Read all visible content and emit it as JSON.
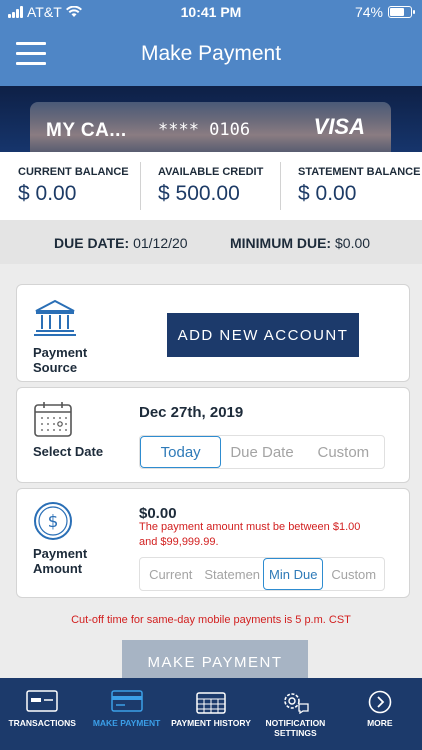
{
  "status_bar": {
    "carrier": "AT&T",
    "time": "10:41 PM",
    "battery": "74%",
    "battery_level": 0.74
  },
  "header": {
    "title": "Make Payment"
  },
  "card": {
    "name": "MY CA...",
    "masked_number": "**** 0106",
    "brand": "VISA"
  },
  "balances": [
    {
      "label": "CURRENT BALANCE",
      "amount": "$ 0.00"
    },
    {
      "label": "AVAILABLE CREDIT",
      "amount": "$ 500.00"
    },
    {
      "label": "STATEMENT BALANCE",
      "amount": "$ 0.00"
    }
  ],
  "due": {
    "due_date_label": "DUE DATE:",
    "due_date_value": "01/12/20",
    "min_due_label": "MINIMUM DUE:",
    "min_due_value": "$0.00"
  },
  "payment_source": {
    "label_line1": "Payment",
    "label_line2": "Source",
    "button": "ADD NEW ACCOUNT",
    "icon": "bank-icon"
  },
  "select_date": {
    "label": "Select Date",
    "value": "Dec 27th, 2019",
    "icon": "calendar-icon",
    "options": [
      "Today",
      "Due Date",
      "Custom"
    ],
    "selected": "Today"
  },
  "payment_amount": {
    "label_line1": "Payment",
    "label_line2": "Amount",
    "value": "$0.00",
    "error": "The payment amount must be between $1.00 and $99,999.99.",
    "icon": "dollar-icon",
    "options": [
      "Current",
      "Statemen",
      "Min Due",
      "Custom"
    ],
    "selected": "Min Due"
  },
  "cutoff_note": "Cut-off time for same-day mobile payments is 5 p.m. CST",
  "make_payment_button": "MAKE PAYMENT",
  "tabs": [
    {
      "label": "TRANSACTIONS",
      "icon": "card-list-icon"
    },
    {
      "label": "MAKE PAYMENT",
      "icon": "card-icon",
      "active": true
    },
    {
      "label": "PAYMENT HISTORY",
      "icon": "calendar-grid-icon"
    },
    {
      "label": "NOTIFICATION SETTINGS",
      "icon": "gear-bubble-icon"
    },
    {
      "label": "MORE",
      "icon": "chevron-right-circle-icon"
    }
  ],
  "colors": {
    "header": "#4f86c6",
    "navy": "#1c3a6b",
    "error": "#d21f1f",
    "accent": "#2e8cd0"
  }
}
